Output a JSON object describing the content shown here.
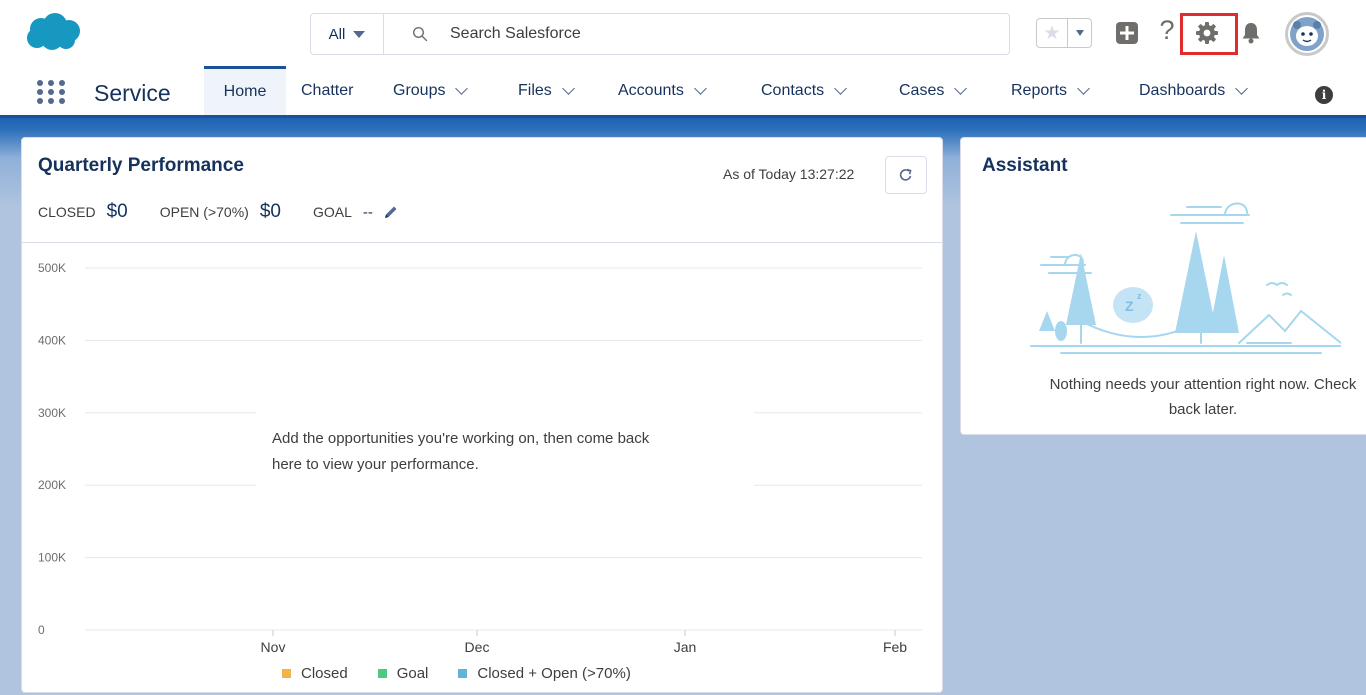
{
  "header": {
    "search": {
      "scope": "All",
      "placeholder": "Search Salesforce"
    },
    "icons": [
      "salesforce-logo",
      "star-icon",
      "plus-icon",
      "help-icon",
      "gear-icon",
      "bell-icon",
      "avatar"
    ],
    "help_glyph": "?"
  },
  "nav": {
    "app_name": "Service",
    "items": [
      {
        "label": "Home",
        "active": true,
        "has_menu": false
      },
      {
        "label": "Chatter",
        "active": false,
        "has_menu": false
      },
      {
        "label": "Groups",
        "active": false,
        "has_menu": true
      },
      {
        "label": "Files",
        "active": false,
        "has_menu": true
      },
      {
        "label": "Accounts",
        "active": false,
        "has_menu": true
      },
      {
        "label": "Contacts",
        "active": false,
        "has_menu": true
      },
      {
        "label": "Cases",
        "active": false,
        "has_menu": true
      },
      {
        "label": "Reports",
        "active": false,
        "has_menu": true
      },
      {
        "label": "Dashboards",
        "active": false,
        "has_menu": true
      }
    ],
    "info_glyph": "i"
  },
  "performance": {
    "title": "Quarterly Performance",
    "as_of": "As of Today 13:27:22",
    "metrics": [
      {
        "label": "CLOSED",
        "value": "$0"
      },
      {
        "label": "OPEN (>70%)",
        "value": "$0"
      },
      {
        "label": "GOAL",
        "value": "--"
      }
    ],
    "empty_message_line1": "Add the opportunities you're working on, then come back",
    "empty_message_line2": "here to view your performance."
  },
  "chart_data": {
    "type": "line",
    "title": "",
    "xlabel": "",
    "ylabel": "",
    "categories": [
      "Nov",
      "Dec",
      "Jan",
      "Feb"
    ],
    "y_ticks": [
      "0",
      "100K",
      "200K",
      "300K",
      "400K",
      "500K"
    ],
    "ylim": [
      0,
      500000
    ],
    "grid": true,
    "series": [
      {
        "name": "Closed",
        "color": "#f4b24c",
        "values": []
      },
      {
        "name": "Goal",
        "color": "#4bca81",
        "values": []
      },
      {
        "name": "Closed + Open (>70%)",
        "color": "#5eb4dc",
        "values": []
      }
    ],
    "legend_position": "bottom"
  },
  "assistant": {
    "title": "Assistant",
    "message_line1": "Nothing needs your attention right now. Check",
    "message_line2": "back later."
  },
  "colors": {
    "brand_blue": "#1b5297",
    "setup_highlight": "#e02c2c",
    "text_primary": "#16325c"
  }
}
